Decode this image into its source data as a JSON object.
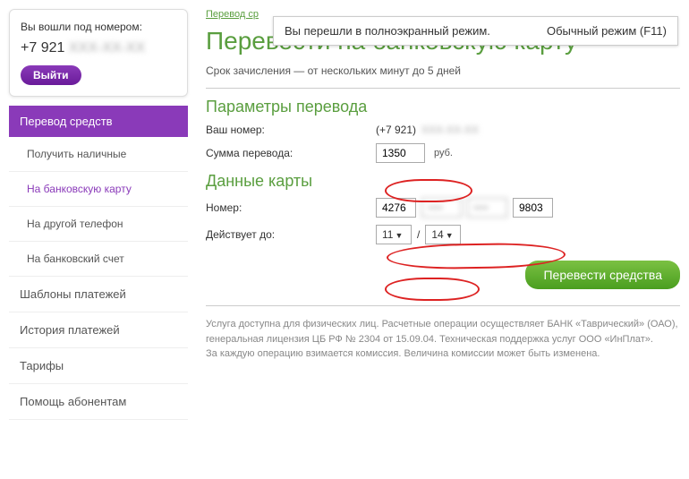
{
  "notification": {
    "message": "Вы перешли в полноэкранный режим.",
    "action": "Обычный режим (F11)"
  },
  "user": {
    "logged_in_label": "Вы вошли под номером:",
    "phone_prefix": "+7 921",
    "phone_rest": "XXX-XX-XX",
    "logout": "Выйти"
  },
  "nav": {
    "header": "Перевод средств",
    "items": [
      "Получить наличные",
      "На банковскую карту",
      "На другой телефон",
      "На банковский счет"
    ],
    "top": [
      "Шаблоны платежей",
      "История платежей",
      "Тарифы",
      "Помощь абонентам"
    ]
  },
  "breadcrumb": {
    "link": "Перевод ср",
    "rest": ""
  },
  "page": {
    "title": "Перевести на банковскую карту",
    "subtitle": "Срок зачисления — от нескольких минут до 5 дней"
  },
  "section1": {
    "title": "Параметры перевода",
    "your_number_label": "Ваш номер:",
    "your_number_value_prefix": "(+7 921)",
    "your_number_value_rest": "XXX-XX-XX",
    "amount_label": "Сумма перевода:",
    "amount_value": "1350",
    "currency": "руб."
  },
  "section2": {
    "title": "Данные карты",
    "card_label": "Номер:",
    "card_parts": [
      "4276",
      "••••",
      "••••",
      "9803"
    ],
    "expiry_label": "Действует до:",
    "expiry_month": "11",
    "expiry_sep": "/",
    "expiry_year": "14"
  },
  "submit": "Перевести средства",
  "footer": {
    "p1": "Услуга доступна для физических лиц. Расчетные операции осуществляет БАНК «Таврический» (ОАО), генеральная лицензия ЦБ РФ № 2304 от 15.09.04. Техническая поддержка услуг ООО «ИнПлат».",
    "p2": "За каждую операцию взимается комиссия. Величина комиссии может быть изменена."
  }
}
